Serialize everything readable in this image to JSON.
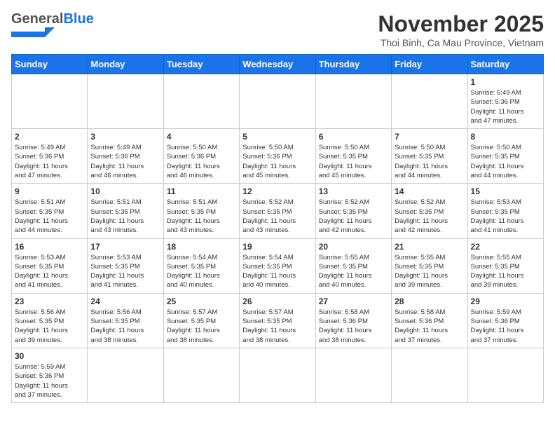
{
  "header": {
    "logo_general": "General",
    "logo_blue": "Blue",
    "month_title": "November 2025",
    "location": "Thoi Binh, Ca Mau Province, Vietnam"
  },
  "weekdays": [
    "Sunday",
    "Monday",
    "Tuesday",
    "Wednesday",
    "Thursday",
    "Friday",
    "Saturday"
  ],
  "weeks": [
    [
      {
        "day": "",
        "info": ""
      },
      {
        "day": "",
        "info": ""
      },
      {
        "day": "",
        "info": ""
      },
      {
        "day": "",
        "info": ""
      },
      {
        "day": "",
        "info": ""
      },
      {
        "day": "",
        "info": ""
      },
      {
        "day": "1",
        "info": "Sunrise: 5:49 AM\nSunset: 5:36 PM\nDaylight: 11 hours\nand 47 minutes."
      }
    ],
    [
      {
        "day": "2",
        "info": "Sunrise: 5:49 AM\nSunset: 5:36 PM\nDaylight: 11 hours\nand 47 minutes."
      },
      {
        "day": "3",
        "info": "Sunrise: 5:49 AM\nSunset: 5:36 PM\nDaylight: 11 hours\nand 46 minutes."
      },
      {
        "day": "4",
        "info": "Sunrise: 5:50 AM\nSunset: 5:36 PM\nDaylight: 11 hours\nand 46 minutes."
      },
      {
        "day": "5",
        "info": "Sunrise: 5:50 AM\nSunset: 5:36 PM\nDaylight: 11 hours\nand 45 minutes."
      },
      {
        "day": "6",
        "info": "Sunrise: 5:50 AM\nSunset: 5:35 PM\nDaylight: 11 hours\nand 45 minutes."
      },
      {
        "day": "7",
        "info": "Sunrise: 5:50 AM\nSunset: 5:35 PM\nDaylight: 11 hours\nand 44 minutes."
      },
      {
        "day": "8",
        "info": "Sunrise: 5:50 AM\nSunset: 5:35 PM\nDaylight: 11 hours\nand 44 minutes."
      }
    ],
    [
      {
        "day": "9",
        "info": "Sunrise: 5:51 AM\nSunset: 5:35 PM\nDaylight: 11 hours\nand 44 minutes."
      },
      {
        "day": "10",
        "info": "Sunrise: 5:51 AM\nSunset: 5:35 PM\nDaylight: 11 hours\nand 43 minutes."
      },
      {
        "day": "11",
        "info": "Sunrise: 5:51 AM\nSunset: 5:35 PM\nDaylight: 11 hours\nand 43 minutes."
      },
      {
        "day": "12",
        "info": "Sunrise: 5:52 AM\nSunset: 5:35 PM\nDaylight: 11 hours\nand 43 minutes."
      },
      {
        "day": "13",
        "info": "Sunrise: 5:52 AM\nSunset: 5:35 PM\nDaylight: 11 hours\nand 42 minutes."
      },
      {
        "day": "14",
        "info": "Sunrise: 5:52 AM\nSunset: 5:35 PM\nDaylight: 11 hours\nand 42 minutes."
      },
      {
        "day": "15",
        "info": "Sunrise: 5:53 AM\nSunset: 5:35 PM\nDaylight: 11 hours\nand 41 minutes."
      }
    ],
    [
      {
        "day": "16",
        "info": "Sunrise: 5:53 AM\nSunset: 5:35 PM\nDaylight: 11 hours\nand 41 minutes."
      },
      {
        "day": "17",
        "info": "Sunrise: 5:53 AM\nSunset: 5:35 PM\nDaylight: 11 hours\nand 41 minutes."
      },
      {
        "day": "18",
        "info": "Sunrise: 5:54 AM\nSunset: 5:35 PM\nDaylight: 11 hours\nand 40 minutes."
      },
      {
        "day": "19",
        "info": "Sunrise: 5:54 AM\nSunset: 5:35 PM\nDaylight: 11 hours\nand 40 minutes."
      },
      {
        "day": "20",
        "info": "Sunrise: 5:55 AM\nSunset: 5:35 PM\nDaylight: 11 hours\nand 40 minutes."
      },
      {
        "day": "21",
        "info": "Sunrise: 5:55 AM\nSunset: 5:35 PM\nDaylight: 11 hours\nand 39 minutes."
      },
      {
        "day": "22",
        "info": "Sunrise: 5:55 AM\nSunset: 5:35 PM\nDaylight: 11 hours\nand 39 minutes."
      }
    ],
    [
      {
        "day": "23",
        "info": "Sunrise: 5:56 AM\nSunset: 5:35 PM\nDaylight: 11 hours\nand 39 minutes."
      },
      {
        "day": "24",
        "info": "Sunrise: 5:56 AM\nSunset: 5:35 PM\nDaylight: 11 hours\nand 38 minutes."
      },
      {
        "day": "25",
        "info": "Sunrise: 5:57 AM\nSunset: 5:35 PM\nDaylight: 11 hours\nand 38 minutes."
      },
      {
        "day": "26",
        "info": "Sunrise: 5:57 AM\nSunset: 5:35 PM\nDaylight: 11 hours\nand 38 minutes."
      },
      {
        "day": "27",
        "info": "Sunrise: 5:58 AM\nSunset: 5:36 PM\nDaylight: 11 hours\nand 38 minutes."
      },
      {
        "day": "28",
        "info": "Sunrise: 5:58 AM\nSunset: 5:36 PM\nDaylight: 11 hours\nand 37 minutes."
      },
      {
        "day": "29",
        "info": "Sunrise: 5:59 AM\nSunset: 5:36 PM\nDaylight: 11 hours\nand 37 minutes."
      }
    ],
    [
      {
        "day": "30",
        "info": "Sunrise: 5:59 AM\nSunset: 5:36 PM\nDaylight: 11 hours\nand 37 minutes."
      },
      {
        "day": "",
        "info": ""
      },
      {
        "day": "",
        "info": ""
      },
      {
        "day": "",
        "info": ""
      },
      {
        "day": "",
        "info": ""
      },
      {
        "day": "",
        "info": ""
      },
      {
        "day": "",
        "info": ""
      }
    ]
  ]
}
